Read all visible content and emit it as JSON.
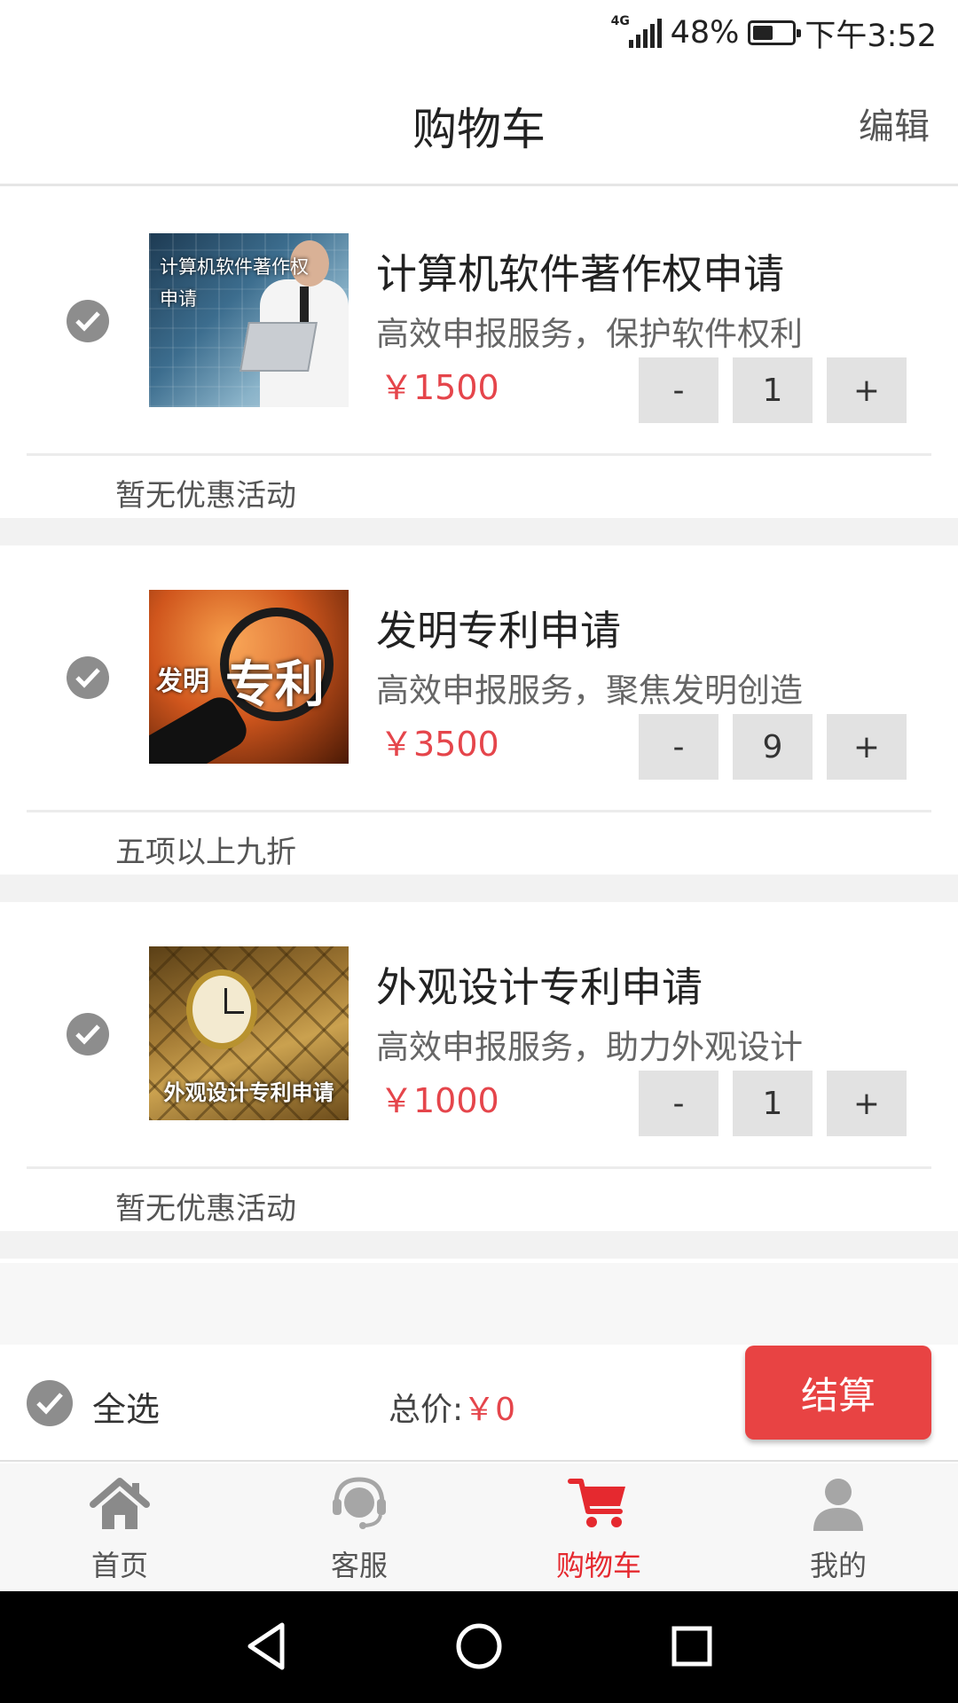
{
  "status_bar": {
    "network": "4G",
    "battery": "48%",
    "battery_level": 0.48,
    "time": "下午3:52"
  },
  "header": {
    "title": "购物车",
    "edit_label": "编辑"
  },
  "cart": {
    "items": [
      {
        "name": "计算机软件著作权申请",
        "desc": "高效申报服务，保护软件权利",
        "price": "￥1500",
        "qty": "1",
        "promo": "暂无优惠活动",
        "image_text": "计算机软件著作权申请",
        "checked": true
      },
      {
        "name": "发明专利申请",
        "desc": "高效申报服务，聚焦发明创造",
        "price": "￥3500",
        "qty": "9",
        "promo": "五项以上九折",
        "image_text_1": "发明",
        "image_text_2": "专利",
        "checked": true
      },
      {
        "name": "外观设计专利申请",
        "desc": "高效申报服务，助力外观设计",
        "price": "￥1000",
        "qty": "1",
        "promo": "暂无优惠活动",
        "image_text": "外观设计专利申请",
        "checked": true
      }
    ],
    "minus_label": "-",
    "plus_label": "+"
  },
  "footer": {
    "select_all_label": "全选",
    "total_label": "总价:",
    "total_value": "￥0",
    "checkout_label": "结算"
  },
  "tabbar": {
    "tabs": [
      {
        "label": "首页",
        "icon": "home-icon"
      },
      {
        "label": "客服",
        "icon": "headset-icon"
      },
      {
        "label": "购物车",
        "icon": "cart-icon"
      },
      {
        "label": "我的",
        "icon": "user-icon"
      }
    ],
    "active_tab": "购物车",
    "active_color": "#e5292f"
  },
  "colors": {
    "price": "#e5454b",
    "checkout_bg": "#e84343"
  }
}
